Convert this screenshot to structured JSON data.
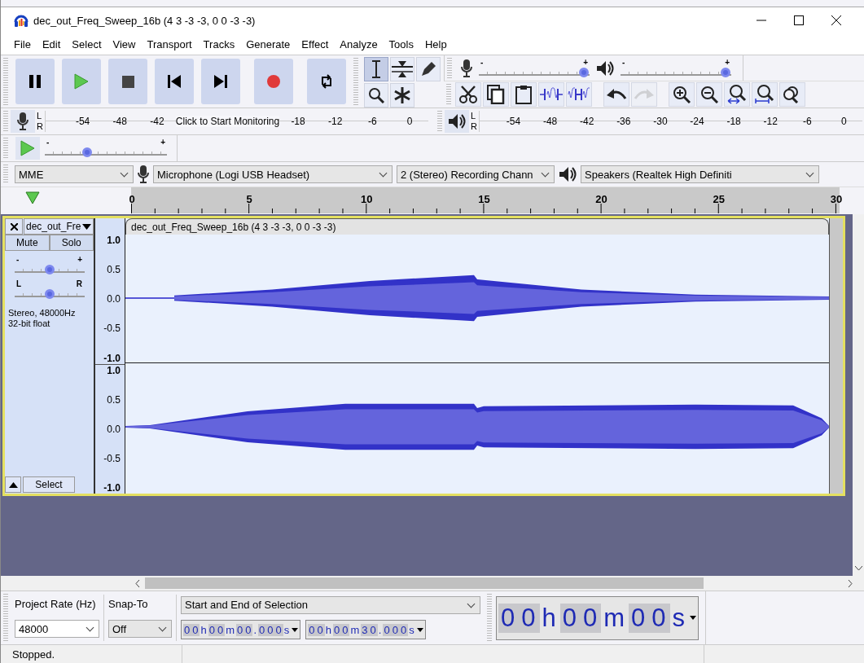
{
  "window": {
    "title": "dec_out_Freq_Sweep_16b (4 3 -3 -3, 0 0 -3 -3)"
  },
  "menu": [
    "File",
    "Edit",
    "Select",
    "View",
    "Transport",
    "Tracks",
    "Generate",
    "Effect",
    "Analyze",
    "Tools",
    "Help"
  ],
  "transport": [
    {
      "kind": "pause"
    },
    {
      "kind": "play"
    },
    {
      "kind": "stop"
    },
    {
      "kind": "skip-start"
    },
    {
      "kind": "skip-end"
    },
    {
      "kind": "record"
    },
    {
      "kind": "loop"
    }
  ],
  "tools": [
    {
      "kind": "select",
      "selected": true
    },
    {
      "kind": "envelope",
      "selected": false
    },
    {
      "kind": "draw",
      "selected": false
    },
    {
      "kind": "zoom",
      "selected": false
    },
    {
      "kind": "multi",
      "selected": false
    }
  ],
  "mixer": {
    "recording_volume": {
      "level": 1,
      "min_label": "-",
      "max_label": "+"
    },
    "playback_volume": {
      "level": 1,
      "min_label": "-",
      "max_label": "+"
    }
  },
  "edit_tools": [
    {
      "kind": "cut",
      "disabled": false
    },
    {
      "kind": "copy",
      "disabled": false
    },
    {
      "kind": "paste",
      "disabled": false
    },
    {
      "kind": "trim",
      "disabled": false
    },
    {
      "kind": "silence",
      "disabled": false
    },
    {
      "kind": "undo",
      "disabled": false
    },
    {
      "kind": "redo",
      "disabled": true
    },
    {
      "kind": "zoom-in",
      "disabled": false
    },
    {
      "kind": "zoom-out",
      "disabled": false
    },
    {
      "kind": "fit-selection",
      "disabled": false
    },
    {
      "kind": "fit-project",
      "disabled": false
    },
    {
      "kind": "zoom-toggle",
      "disabled": false
    }
  ],
  "recording_meter": {
    "channels": [
      "L",
      "R"
    ],
    "ticks_before": [
      "-54",
      "-48",
      "-42"
    ],
    "prompt": "Click to Start Monitoring",
    "ticks_after": [
      "-18",
      "-12",
      "-6",
      "0"
    ]
  },
  "playback_meter": {
    "channels": [
      "L",
      "R"
    ],
    "ticks": [
      "-54",
      "-48",
      "-42",
      "-36",
      "-30",
      "-24",
      "-18",
      "-12",
      "-6",
      "0"
    ]
  },
  "play_at_speed": {
    "level": 0.33,
    "min_label": "-",
    "max_label": "+"
  },
  "devices": {
    "host": "MME",
    "recording_device": "Microphone (Logi USB Headset)",
    "channels": "2 (Stereo) Recording Chann",
    "playback_device": "Speakers (Realtek High Definiti"
  },
  "timeline": {
    "ticks": [
      "0",
      "5",
      "10",
      "15",
      "20",
      "25",
      "30"
    ]
  },
  "track": {
    "name": "dec_out_Fre",
    "mute": "Mute",
    "solo": "Solo",
    "gain": {
      "level": 0.5,
      "min_label": "-",
      "max_label": "+"
    },
    "pan": {
      "level": 0.5,
      "min_label": "L",
      "max_label": "R"
    },
    "info": [
      "Stereo, 48000Hz",
      "32-bit float"
    ],
    "select": "Select",
    "clip_title": "dec_out_Freq_Sweep_16b (4 3 -3 -3, 0 0 -3 -3)",
    "channels": [
      {
        "scale": [
          "1.0",
          "0.5",
          "0.0",
          "-0.5",
          "-1.0"
        ]
      },
      {
        "scale": [
          "1.0",
          "0.5",
          "0.0",
          "-0.5",
          "-1.0"
        ]
      }
    ]
  },
  "selection_toolbar": {
    "project_rate_label": "Project Rate (Hz)",
    "project_rate": "48000",
    "snap_to_label": "Snap-To",
    "snap_to": "Off",
    "selection_mode": "Start and End of Selection",
    "start": "00h00m00.000s",
    "end": "00h00m30.000s"
  },
  "audio_position": "00h00m00s",
  "status": "Stopped."
}
